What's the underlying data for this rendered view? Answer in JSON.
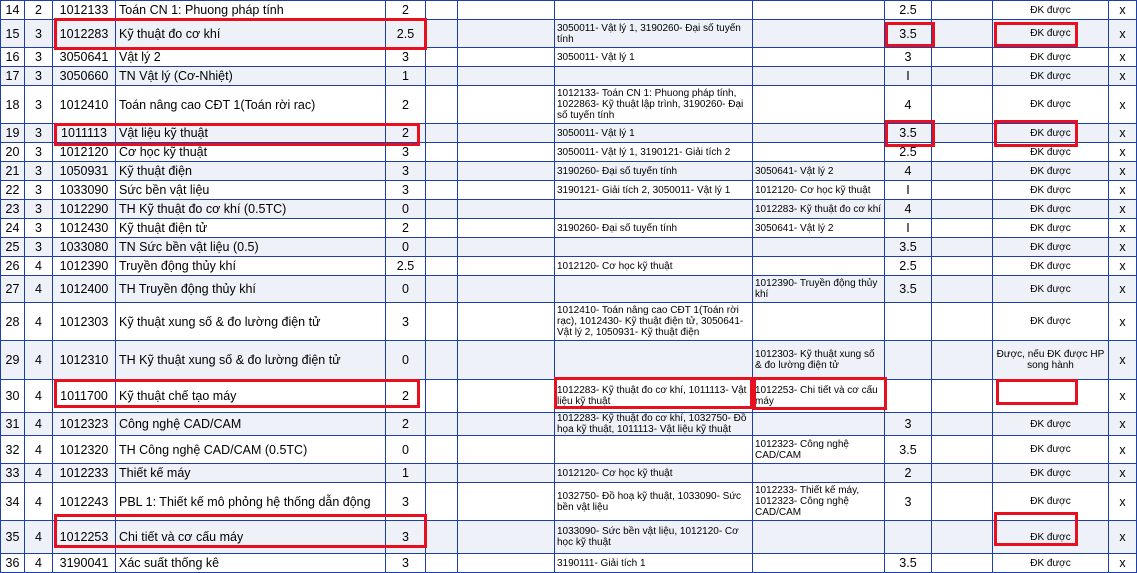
{
  "highlight_color": "#e8101e",
  "rows": [
    {
      "no": "14",
      "sem": "2",
      "code": "1012133",
      "name": "Toán CN 1: Phuong pháp tính",
      "credits": "2",
      "c6": "",
      "c7": "",
      "prereq": "",
      "coreq": "",
      "grade": "2.5",
      "c11": "",
      "status": "ĐK được",
      "x": "x"
    },
    {
      "no": "15",
      "sem": "3",
      "code": "1012283",
      "name": "Kỹ thuật đo cơ khí",
      "credits": "2.5",
      "c6": "",
      "c7": "",
      "prereq": "3050011- Vật lý 1, 3190260- Đại số tuyến tính",
      "coreq": "",
      "grade": "3.5",
      "c11": "",
      "status": "ĐK được",
      "x": "x"
    },
    {
      "no": "16",
      "sem": "3",
      "code": "3050641",
      "name": "Vật lý 2",
      "credits": "3",
      "c6": "",
      "c7": "",
      "prereq": "3050011- Vật lý 1",
      "coreq": "",
      "grade": "3",
      "c11": "",
      "status": "ĐK được",
      "x": "x"
    },
    {
      "no": "17",
      "sem": "3",
      "code": "3050660",
      "name": "TN Vật lý (Cơ-Nhiệt)",
      "credits": "1",
      "c6": "",
      "c7": "",
      "prereq": "",
      "coreq": "",
      "grade": "I",
      "c11": "",
      "status": "ĐK được",
      "x": "x"
    },
    {
      "no": "18",
      "sem": "3",
      "code": "1012410",
      "name": "Toán nâng cao CĐT 1(Toán rời rac)",
      "credits": "2",
      "c6": "",
      "c7": "",
      "prereq": "1012133- Toán CN 1: Phuong pháp tính, 1022863- Kỹ thuật lập trình, 3190260- Đại số tuyến tính",
      "coreq": "",
      "grade": "4",
      "c11": "",
      "status": "ĐK được",
      "x": "x"
    },
    {
      "no": "19",
      "sem": "3",
      "code": "1011113",
      "name": "Vật liệu kỹ thuật",
      "credits": "2",
      "c6": "",
      "c7": "",
      "prereq": "3050011- Vật lý 1",
      "coreq": "",
      "grade": "3.5",
      "c11": "",
      "status": "ĐK được",
      "x": "x"
    },
    {
      "no": "20",
      "sem": "3",
      "code": "1012120",
      "name": "Cơ học kỹ thuật",
      "credits": "3",
      "c6": "",
      "c7": "",
      "prereq": "3050011- Vật lý 1, 3190121- Giải tích 2",
      "coreq": "",
      "grade": "2.5",
      "c11": "",
      "status": "ĐK được",
      "x": "x"
    },
    {
      "no": "21",
      "sem": "3",
      "code": "1050931",
      "name": "Kỹ thuật điện",
      "credits": "3",
      "c6": "",
      "c7": "",
      "prereq": "3190260- Đại số tuyến tính",
      "coreq": "3050641- Vật lý 2",
      "grade": "4",
      "c11": "",
      "status": "ĐK được",
      "x": "x"
    },
    {
      "no": "22",
      "sem": "3",
      "code": "1033090",
      "name": "Sức bền vật liệu",
      "credits": "3",
      "c6": "",
      "c7": "",
      "prereq": "3190121- Giải tích 2, 3050011- Vật lý 1",
      "coreq": "1012120- Cơ học kỹ thuật",
      "grade": "I",
      "c11": "",
      "status": "ĐK được",
      "x": "x"
    },
    {
      "no": "23",
      "sem": "3",
      "code": "1012290",
      "name": "TH Kỹ thuật đo cơ khí (0.5TC)",
      "credits": "0",
      "c6": "",
      "c7": "",
      "prereq": "",
      "coreq": "1012283- Kỹ thuật đo cơ khí",
      "grade": "4",
      "c11": "",
      "status": "ĐK được",
      "x": "x"
    },
    {
      "no": "24",
      "sem": "3",
      "code": "1012430",
      "name": "Kỹ thuật điện tử",
      "credits": "2",
      "c6": "",
      "c7": "",
      "prereq": "3190260- Đại số tuyến tính",
      "coreq": "3050641- Vật lý 2",
      "grade": "I",
      "c11": "",
      "status": "ĐK được",
      "x": "x"
    },
    {
      "no": "25",
      "sem": "3",
      "code": "1033080",
      "name": "TN Sức bền vật liệu (0.5)",
      "credits": "0",
      "c6": "",
      "c7": "",
      "prereq": "",
      "coreq": "",
      "grade": "3.5",
      "c11": "",
      "status": "ĐK được",
      "x": "x"
    },
    {
      "no": "26",
      "sem": "4",
      "code": "1012390",
      "name": "Truyền động thủy khí",
      "credits": "2.5",
      "c6": "",
      "c7": "",
      "prereq": "1012120- Cơ học kỹ thuật",
      "coreq": "",
      "grade": "2.5",
      "c11": "",
      "status": "ĐK được",
      "x": "x"
    },
    {
      "no": "27",
      "sem": "4",
      "code": "1012400",
      "name": "TH Truyền động thủy khí",
      "credits": "0",
      "c6": "",
      "c7": "",
      "prereq": "",
      "coreq": "1012390- Truyền động thủy khí",
      "grade": "3.5",
      "c11": "",
      "status": "ĐK được",
      "x": "x"
    },
    {
      "no": "28",
      "sem": "4",
      "code": "1012303",
      "name": "Kỹ thuật xung số & đo lường điện tử",
      "credits": "3",
      "c6": "",
      "c7": "",
      "prereq": "1012410- Toán nâng cao CĐT 1(Toán rời rạc), 1012430- Kỹ thuật điện tử, 3050641- Vật lý 2, 1050931- Kỹ thuật điện",
      "coreq": "",
      "grade": "",
      "c11": "",
      "status": "ĐK được",
      "x": "x"
    },
    {
      "no": "29",
      "sem": "4",
      "code": "1012310",
      "name": "TH Kỹ thuật xung số & đo lường điện tử",
      "credits": "0",
      "c6": "",
      "c7": "",
      "prereq": "",
      "coreq": "1012303- Kỹ thuật xung số & đo lường điện tử",
      "grade": "",
      "c11": "",
      "status": "Được, nếu ĐK được HP song hành",
      "x": "x"
    },
    {
      "no": "30",
      "sem": "4",
      "code": "1011700",
      "name": "Kỹ thuật chế tạo máy",
      "credits": "2",
      "c6": "",
      "c7": "",
      "prereq": "1012283- Kỹ thuật đo cơ khí, 1011113- Vật liệu kỹ thuật",
      "coreq": "1012253- Chi tiết và cơ cấu máy",
      "grade": "",
      "c11": "",
      "status": "",
      "x": "x"
    },
    {
      "no": "31",
      "sem": "4",
      "code": "1012323",
      "name": "Công nghệ CAD/CAM",
      "credits": "2",
      "c6": "",
      "c7": "",
      "prereq": "1012283- Kỹ thuật đo cơ khí, 1032750- Đồ họa kỹ thuật, 1011113- Vật liệu kỹ thuật",
      "coreq": "",
      "grade": "3",
      "c11": "",
      "status": "ĐK được",
      "x": "x"
    },
    {
      "no": "32",
      "sem": "4",
      "code": "1012320",
      "name": "TH Công nghệ CAD/CAM (0.5TC)",
      "credits": "0",
      "c6": "",
      "c7": "",
      "prereq": "",
      "coreq": "1012323- Công nghệ CAD/CAM",
      "grade": "3.5",
      "c11": "",
      "status": "ĐK được",
      "x": "x"
    },
    {
      "no": "33",
      "sem": "4",
      "code": "1012233",
      "name": "Thiết kế máy",
      "credits": "1",
      "c6": "",
      "c7": "",
      "prereq": "1012120- Cơ học kỹ thuật",
      "coreq": "",
      "grade": "2",
      "c11": "",
      "status": "ĐK được",
      "x": "x"
    },
    {
      "no": "34",
      "sem": "4",
      "code": "1012243",
      "name": "PBL 1: Thiết kế mô phỏng hệ thống dẫn động",
      "credits": "3",
      "c6": "",
      "c7": "",
      "prereq": "1032750- Đồ hoạ kỹ thuật, 1033090- Sức bền vật liệu",
      "coreq": "1012233- Thiết kế máy, 1012323- Công nghệ CAD/CAM",
      "grade": "3",
      "c11": "",
      "status": "ĐK được",
      "x": "x"
    },
    {
      "no": "35",
      "sem": "4",
      "code": "1012253",
      "name": "Chi tiết và cơ cấu máy",
      "credits": "3",
      "c6": "",
      "c7": "",
      "prereq": "1033090- Sức bền vật liệu, 1012120- Cơ học kỹ thuật",
      "coreq": "",
      "grade": "",
      "c11": "",
      "status": "ĐK được",
      "x": "x"
    },
    {
      "no": "36",
      "sem": "4",
      "code": "3190041",
      "name": "Xác suất thống kê",
      "credits": "3",
      "c6": "",
      "c7": "",
      "prereq": "3190111- Giải tích 1",
      "coreq": "",
      "grade": "3.5",
      "c11": "",
      "status": "ĐK được",
      "x": "x"
    }
  ]
}
